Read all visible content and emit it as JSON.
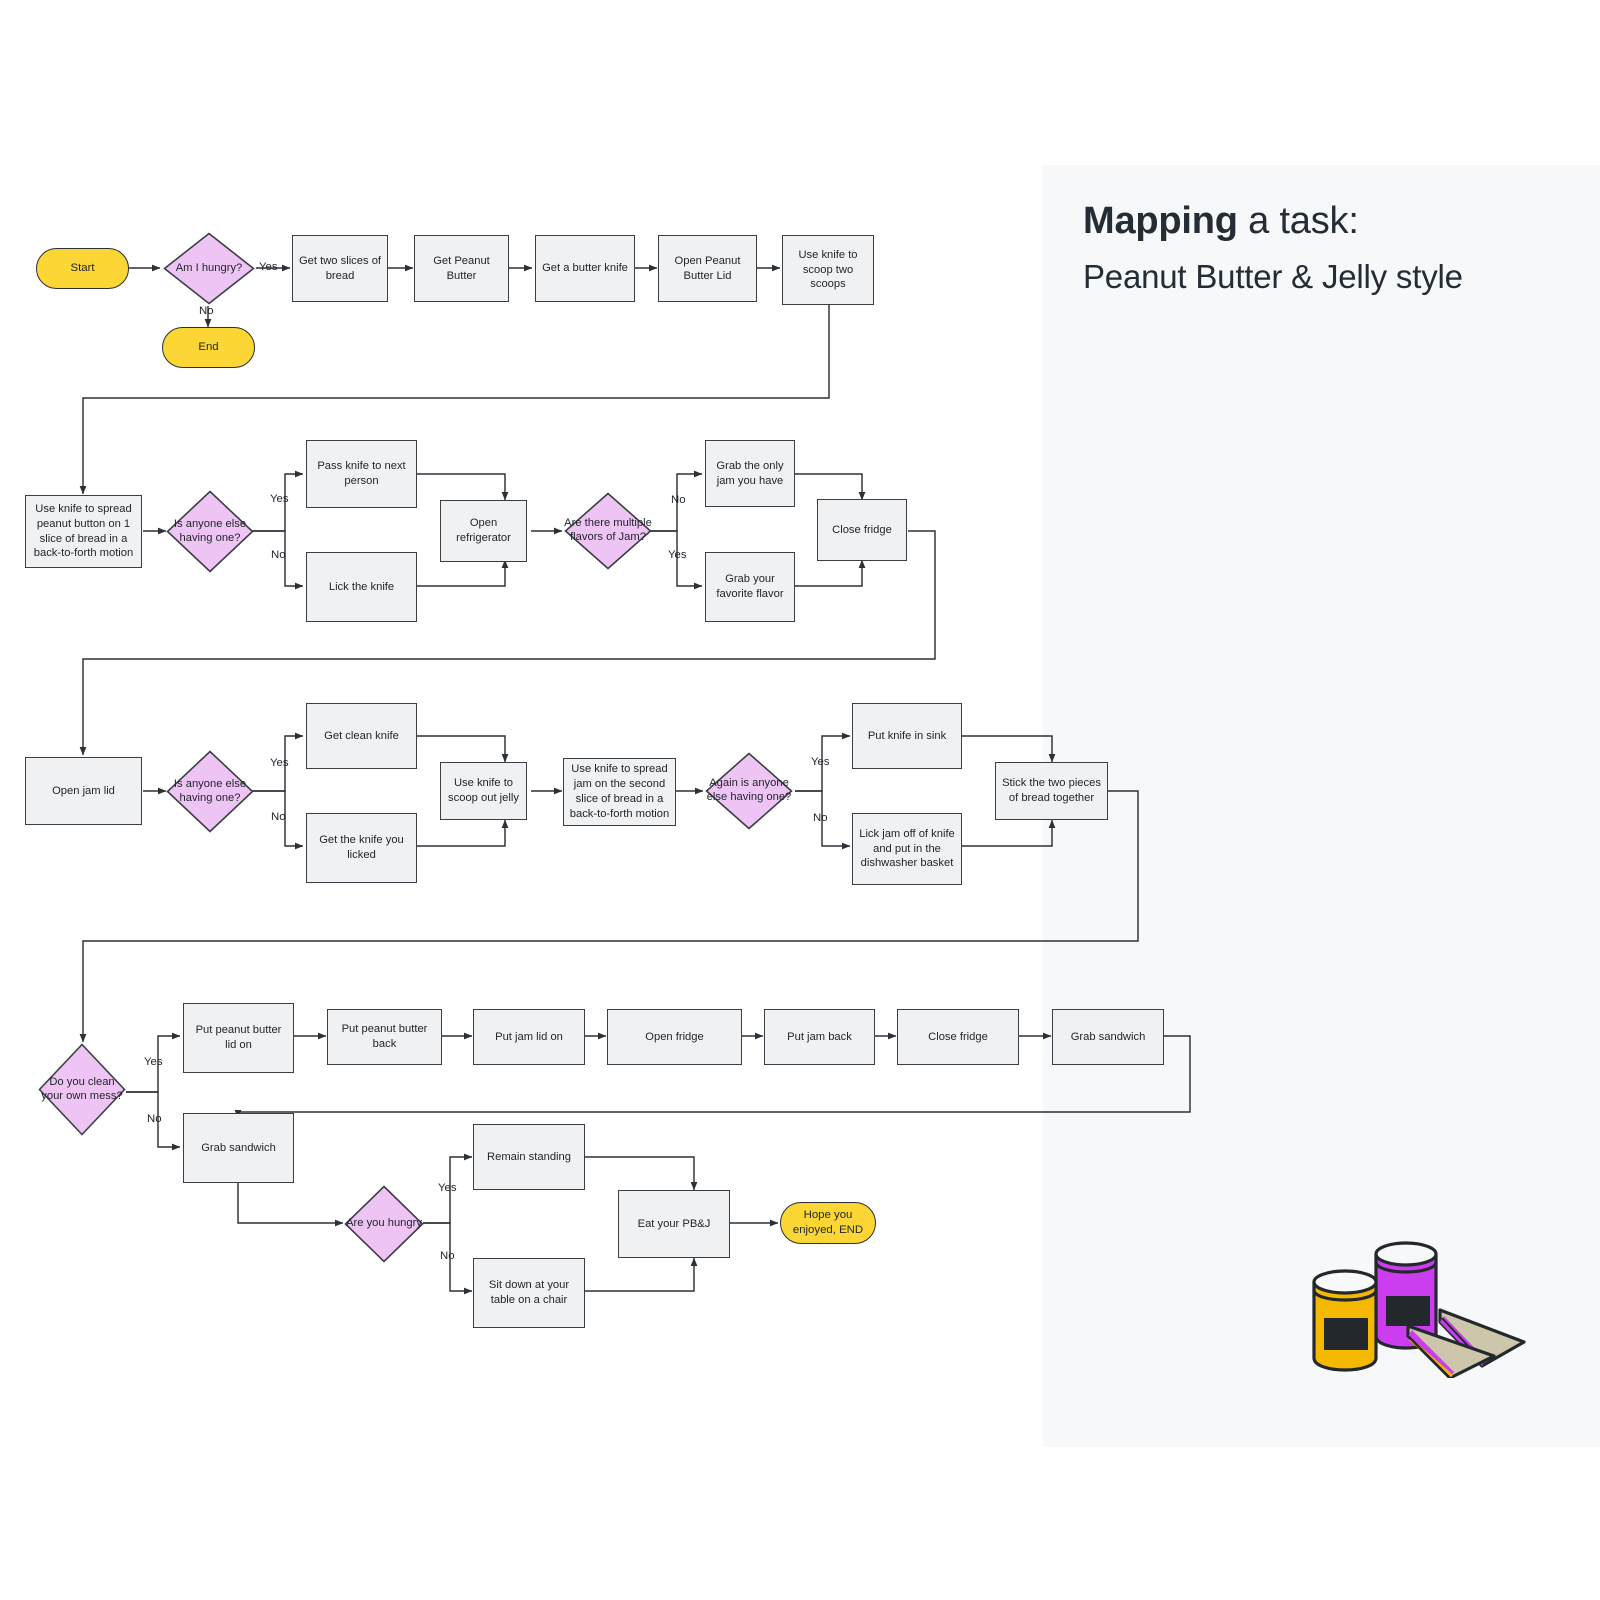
{
  "panel": {
    "title_bold": "Mapping",
    "title_rest": " a task:",
    "subtitle": "Peanut Butter & Jelly style"
  },
  "illustration": {
    "name": "peanut-butter-jelly-jars-and-sandwich",
    "jar_left_color": "#f5b800",
    "jar_right_color": "#cc3df0",
    "label_color": "#23282d",
    "bread_color": "#cdc6ab",
    "jelly_color": "#cc3df0"
  },
  "colors": {
    "terminal_fill": "#fcd634",
    "decision_fill": "#eec4f5",
    "process_fill": "#f0f1f2",
    "stroke": "#3b3f45",
    "panel_bg": "#f7f8fa",
    "text": "#1f2429"
  },
  "nodes": [
    {
      "id": "start",
      "type": "terminal",
      "label": "Start"
    },
    {
      "id": "d_hungry",
      "type": "decision",
      "label": "Am I hungry?"
    },
    {
      "id": "end_early",
      "type": "terminal",
      "label": "End"
    },
    {
      "id": "two_slices",
      "type": "process",
      "label": "Get two slices of bread"
    },
    {
      "id": "get_pb",
      "type": "process",
      "label": "Get Peanut Butter"
    },
    {
      "id": "get_knife",
      "type": "process",
      "label": "Get a butter knife"
    },
    {
      "id": "open_pb_lid",
      "type": "process",
      "label": "Open Peanut Butter Lid"
    },
    {
      "id": "scoop_two",
      "type": "process",
      "label": "Use knife to scoop two scoops"
    },
    {
      "id": "spread_pb",
      "type": "process",
      "label": "Use knife to spread peanut button on 1 slice of bread in a back-to-forth motion"
    },
    {
      "id": "d_anyone1",
      "type": "decision",
      "label": "Is anyone else having one?"
    },
    {
      "id": "pass_knife",
      "type": "process",
      "label": "Pass knife to next person"
    },
    {
      "id": "lick_knife",
      "type": "process",
      "label": "Lick the knife"
    },
    {
      "id": "open_fridge1",
      "type": "process",
      "label": "Open refrigerator"
    },
    {
      "id": "d_flavors",
      "type": "decision",
      "label": "Are there multiple flavors of Jam?"
    },
    {
      "id": "only_jam",
      "type": "process",
      "label": "Grab the only jam you have"
    },
    {
      "id": "fav_flavor",
      "type": "process",
      "label": "Grab your favorite flavor"
    },
    {
      "id": "close_fridge1",
      "type": "process",
      "label": "Close fridge"
    },
    {
      "id": "open_jam_lid",
      "type": "process",
      "label": "Open jam lid"
    },
    {
      "id": "d_anyone2",
      "type": "decision",
      "label": "Is anyone else having one?"
    },
    {
      "id": "clean_knife",
      "type": "process",
      "label": "Get clean knife"
    },
    {
      "id": "licked_knife",
      "type": "process",
      "label": "Get the knife you licked"
    },
    {
      "id": "scoop_jelly",
      "type": "process",
      "label": "Use knife to scoop out jelly"
    },
    {
      "id": "spread_jam",
      "type": "process",
      "label": "Use knife to spread jam on the second slice of bread in a back-to-forth motion"
    },
    {
      "id": "d_anyone3",
      "type": "decision",
      "label": "Again is anyone else having one?"
    },
    {
      "id": "knife_sink",
      "type": "process",
      "label": "Put knife in sink"
    },
    {
      "id": "lick_jam",
      "type": "process",
      "label": "Lick jam off of knife and put in the dishwasher basket"
    },
    {
      "id": "stick_bread",
      "type": "process",
      "label": "Stick the two pieces of bread together"
    },
    {
      "id": "d_clean",
      "type": "decision",
      "label": "Do you clean your own mess?"
    },
    {
      "id": "pb_lid_on",
      "type": "process",
      "label": "Put peanut butter lid on"
    },
    {
      "id": "pb_back",
      "type": "process",
      "label": "Put peanut butter back"
    },
    {
      "id": "jam_lid_on",
      "type": "process",
      "label": "Put jam lid on"
    },
    {
      "id": "open_fridge2",
      "type": "process",
      "label": "Open fridge"
    },
    {
      "id": "jam_back",
      "type": "process",
      "label": "Put jam back"
    },
    {
      "id": "close_fridge2",
      "type": "process",
      "label": "Close fridge"
    },
    {
      "id": "grab_sw_top",
      "type": "process",
      "label": "Grab sandwich"
    },
    {
      "id": "grab_sw_bot",
      "type": "process",
      "label": "Grab sandwich"
    },
    {
      "id": "d_hungry2",
      "type": "decision",
      "label": "Are you hungry"
    },
    {
      "id": "stand",
      "type": "process",
      "label": "Remain standing"
    },
    {
      "id": "sit",
      "type": "process",
      "label": "Sit down at your table on a chair"
    },
    {
      "id": "eat",
      "type": "process",
      "label": "Eat your PB&J"
    },
    {
      "id": "end_final",
      "type": "terminal",
      "label": "Hope you enjoyed, END"
    }
  ],
  "edge_labels": [
    {
      "id": "yes1",
      "text": "Yes"
    },
    {
      "id": "no1",
      "text": "No"
    },
    {
      "id": "yes2",
      "text": "Yes"
    },
    {
      "id": "no2",
      "text": "No"
    },
    {
      "id": "no3",
      "text": "No"
    },
    {
      "id": "yes3",
      "text": "Yes"
    },
    {
      "id": "yes4",
      "text": "Yes"
    },
    {
      "id": "no4",
      "text": "No"
    },
    {
      "id": "yes5",
      "text": "Yes"
    },
    {
      "id": "no5",
      "text": "No"
    },
    {
      "id": "yes6",
      "text": "Yes"
    },
    {
      "id": "no6",
      "text": "No"
    },
    {
      "id": "yes7",
      "text": "Yes"
    },
    {
      "id": "no7",
      "text": "No"
    }
  ]
}
